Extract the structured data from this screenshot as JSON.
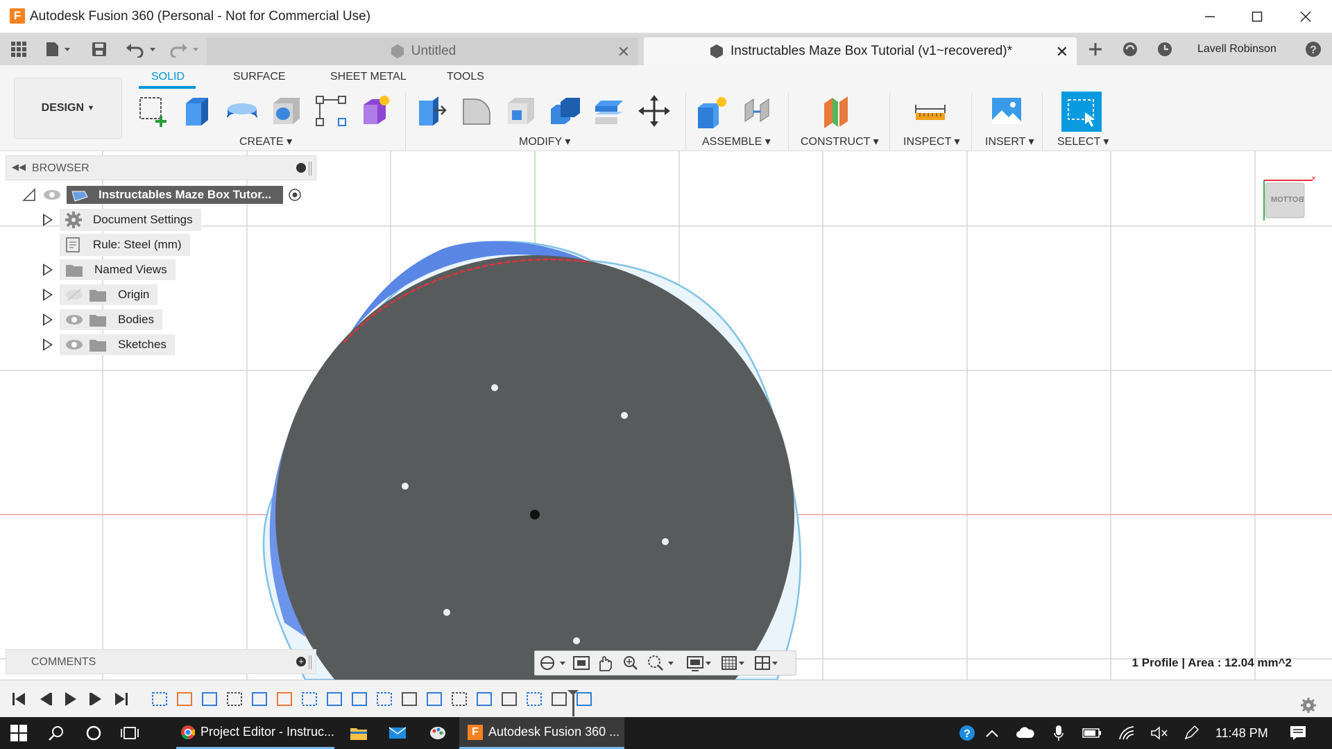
{
  "window": {
    "app_title": "Autodesk Fusion 360 (Personal - Not for Commercial Use)",
    "logo_letter": "F"
  },
  "tabs": [
    {
      "label": "Untitled",
      "active": false
    },
    {
      "label": "Instructables Maze Box Tutorial (v1~recovered)*",
      "active": true
    }
  ],
  "user": {
    "name": "Lavell Robinson"
  },
  "toolbar": {
    "workspace": "DESIGN",
    "workspace_tabs": [
      "SOLID",
      "SURFACE",
      "SHEET METAL",
      "TOOLS"
    ],
    "groups": [
      "CREATE",
      "MODIFY",
      "ASSEMBLE",
      "CONSTRUCT",
      "INSPECT",
      "INSERT",
      "SELECT"
    ]
  },
  "browser": {
    "header": "BROWSER",
    "root": "Instructables Maze Box Tutor...",
    "items": [
      {
        "label": "Document Settings",
        "icon": "gear-icon"
      },
      {
        "label": "Rule: Steel (mm)",
        "icon": "rule-icon"
      },
      {
        "label": "Named Views",
        "icon": "folder-icon"
      },
      {
        "label": "Origin",
        "icon": "folder-icon"
      },
      {
        "label": "Bodies",
        "icon": "folder-icon"
      },
      {
        "label": "Sketches",
        "icon": "folder-icon"
      }
    ]
  },
  "comments": {
    "header": "COMMENTS"
  },
  "viewcube": {
    "face_label": "BOTTOM"
  },
  "status": {
    "text": "1 Profile | Area : 12.04 mm^2"
  },
  "taskbar": {
    "apps": [
      {
        "label": "Project Editor - Instruc...",
        "icon": "chrome-icon"
      },
      {
        "label": "Autodesk Fusion 360 ...",
        "icon": "fusion-icon"
      }
    ],
    "clock": "11:48 PM"
  },
  "colors": {
    "accent": "#0696d7",
    "body_fill": "#585b5c",
    "sketch_blue": "#5a86e6",
    "sketch_outline": "#7fc3e6",
    "selection_red": "#e0333a",
    "taskbar_bg": "#1c1c1c"
  }
}
